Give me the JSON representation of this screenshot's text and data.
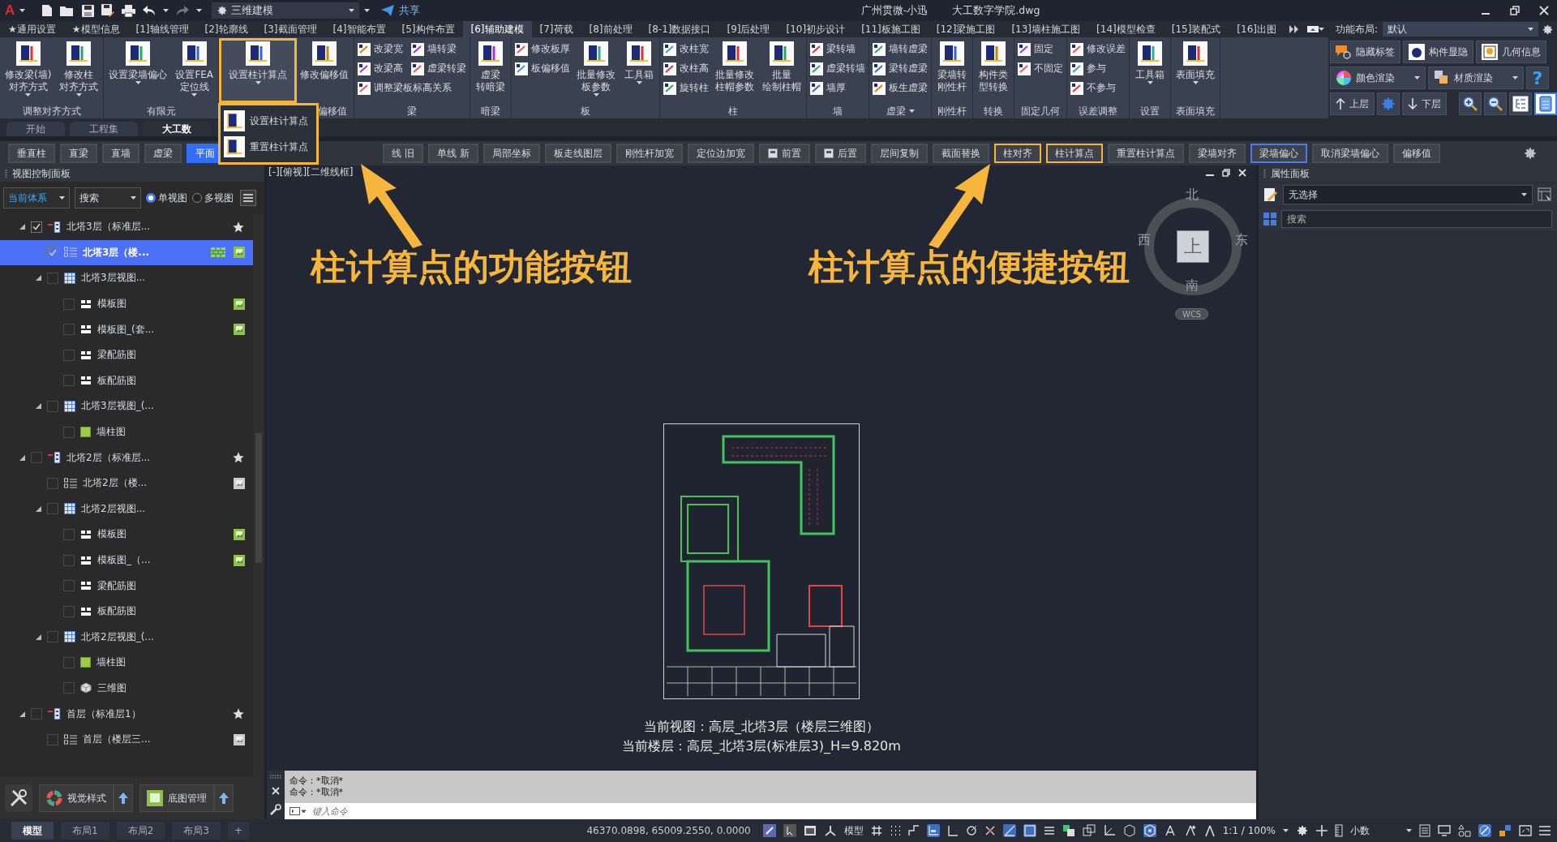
{
  "title_bar": {
    "app_logo": "A",
    "workspace": "三维建模",
    "share": "共享",
    "title": "广州贯微-小迅",
    "file": "大工数字学院.dwg"
  },
  "ribbon_tabs": [
    {
      "label": "★通用设置",
      "selected": false
    },
    {
      "label": "★模型信息",
      "selected": false
    },
    {
      "label": "[1]轴线管理",
      "selected": false
    },
    {
      "label": "[2]轮廓线",
      "selected": false
    },
    {
      "label": "[3]截面管理",
      "selected": false
    },
    {
      "label": "[4]智能布置",
      "selected": false
    },
    {
      "label": "[5]构件布置",
      "selected": false
    },
    {
      "label": "[6]辅助建模",
      "selected": true
    },
    {
      "label": "[7]荷载",
      "selected": false
    },
    {
      "label": "[8]前处理",
      "selected": false
    },
    {
      "label": "[8-1]数据接口",
      "selected": false
    },
    {
      "label": "[9]后处理",
      "selected": false
    },
    {
      "label": "[10]初步设计",
      "selected": false
    },
    {
      "label": "[11]板施工图",
      "selected": false
    },
    {
      "label": "[12]梁施工图",
      "selected": false
    },
    {
      "label": "[13]墙柱施工图",
      "selected": false
    },
    {
      "label": "[14]模型检查",
      "selected": false
    },
    {
      "label": "[15]装配式",
      "selected": false
    },
    {
      "label": "[16]出图",
      "selected": false
    }
  ],
  "function_layout": {
    "label": "功能布局:",
    "value": "默认"
  },
  "ribbon": {
    "groups": [
      {
        "label": "调整对齐方式",
        "label_menu": false,
        "columns": [
          {
            "kind": "large",
            "lines": [
              "修改梁(墙)",
              "对齐方式"
            ],
            "menu": true,
            "highlighted": false
          },
          {
            "kind": "large",
            "lines": [
              "修改柱",
              "对齐方式"
            ],
            "menu": true,
            "highlighted": false
          }
        ]
      },
      {
        "label": "有限元",
        "label_menu": false,
        "columns": [
          {
            "kind": "large",
            "lines": [
              "设置梁墙偏心"
            ],
            "menu": true,
            "highlighted": false
          },
          {
            "kind": "large",
            "lines": [
              "设置FEA",
              "定位线"
            ],
            "menu": true,
            "highlighted": false
          }
        ]
      },
      {
        "label": "偏移值",
        "label_menu": false,
        "columns": [
          {
            "kind": "large",
            "lines": [
              "设置柱计算点"
            ],
            "menu": true,
            "highlighted": true,
            "dropdown": [
              "设置柱计算点",
              "重置柱计算点"
            ]
          },
          {
            "kind": "large",
            "lines": [
              "修改偏移值"
            ],
            "menu": false,
            "highlighted": false
          }
        ]
      },
      {
        "label": "梁",
        "label_menu": false,
        "columns": [
          {
            "kind": "small",
            "rows": [
              [
                "改梁宽",
                "墙转梁"
              ],
              [
                "改梁高",
                "虚梁转梁"
              ],
              [
                "调整梁板标高关系"
              ]
            ]
          }
        ]
      },
      {
        "label": "暗梁",
        "label_menu": false,
        "columns": [
          {
            "kind": "large",
            "lines": [
              "虚梁",
              "转暗梁"
            ],
            "menu": false,
            "highlighted": false
          }
        ]
      },
      {
        "label": "板",
        "label_menu": false,
        "columns": [
          {
            "kind": "small",
            "rows": [
              [
                "修改板厚"
              ],
              [
                "板偏移值"
              ]
            ]
          },
          {
            "kind": "large",
            "lines": [
              "批量修改",
              "板参数"
            ],
            "menu": true,
            "highlighted": false
          },
          {
            "kind": "large",
            "lines": [
              "工具箱"
            ],
            "menu": true,
            "highlighted": false
          }
        ]
      },
      {
        "label": "柱",
        "label_menu": false,
        "columns": [
          {
            "kind": "small",
            "rows": [
              [
                "改柱宽"
              ],
              [
                "改柱高"
              ],
              [
                "旋转柱"
              ]
            ]
          },
          {
            "kind": "large",
            "lines": [
              "批量修改",
              "柱帽参数"
            ],
            "menu": false,
            "highlighted": false
          },
          {
            "kind": "large",
            "lines": [
              "批量",
              "绘制柱帽"
            ],
            "menu": false,
            "highlighted": false
          }
        ]
      },
      {
        "label": "墙",
        "label_menu": false,
        "columns": [
          {
            "kind": "small",
            "rows": [
              [
                "梁转墙"
              ],
              [
                "虚梁转墙"
              ],
              [
                "墙厚"
              ]
            ]
          }
        ]
      },
      {
        "label": "虚梁",
        "label_menu": true,
        "columns": [
          {
            "kind": "small",
            "rows": [
              [
                "墙转虚梁"
              ],
              [
                "梁转虚梁"
              ],
              [
                "板生虚梁"
              ]
            ]
          }
        ]
      },
      {
        "label": "刚性杆",
        "label_menu": false,
        "columns": [
          {
            "kind": "large",
            "lines": [
              "梁墙转",
              "刚性杆"
            ],
            "menu": false,
            "highlighted": false
          }
        ]
      },
      {
        "label": "转换",
        "label_menu": false,
        "columns": [
          {
            "kind": "large",
            "lines": [
              "构件类",
              "型转换"
            ],
            "menu": false,
            "highlighted": false
          }
        ]
      },
      {
        "label": "固定几何",
        "label_menu": false,
        "columns": [
          {
            "kind": "small",
            "rows": [
              [
                "固定"
              ],
              [
                "不固定"
              ]
            ]
          }
        ]
      },
      {
        "label": "误差调整",
        "label_menu": false,
        "columns": [
          {
            "kind": "small",
            "rows": [
              [
                "修改误差"
              ],
              [
                "参与"
              ],
              [
                "不参与"
              ]
            ]
          }
        ]
      },
      {
        "label": "设置",
        "label_menu": false,
        "columns": [
          {
            "kind": "large",
            "lines": [
              "工具箱"
            ],
            "menu": true,
            "highlighted": false
          }
        ]
      },
      {
        "label": "表面填充",
        "label_menu": false,
        "columns": [
          {
            "kind": "large",
            "lines": [
              "表面填充"
            ],
            "menu": true,
            "highlighted": false
          }
        ]
      }
    ]
  },
  "display_tools": {
    "tag_buttons": [
      "隐藏标签",
      "构件显隐",
      "几何信息"
    ],
    "render_buttons": [
      "颜色渲染",
      "材质渲染"
    ],
    "help": "?",
    "floor_up": "上层",
    "floor_down": "下层"
  },
  "doc_tabs": [
    {
      "label": "开始",
      "selected": false
    },
    {
      "label": "工程集",
      "selected": false
    },
    {
      "label": "大工数",
      "selected": true
    }
  ],
  "toolbar": [
    {
      "label": "垂直柱",
      "kind": "button",
      "selected": false,
      "focused": false,
      "highlighted": false
    },
    {
      "label": "直梁",
      "kind": "button",
      "selected": false,
      "focused": false,
      "highlighted": false
    },
    {
      "label": "直墙",
      "kind": "button",
      "selected": false,
      "focused": false,
      "highlighted": false
    },
    {
      "label": "虚梁",
      "kind": "button",
      "selected": false,
      "focused": false,
      "highlighted": false
    },
    {
      "label": "平面",
      "kind": "button",
      "selected": true,
      "focused": false,
      "highlighted": false
    },
    {
      "label": "线 旧",
      "kind": "button",
      "selected": false,
      "focused": false,
      "highlighted": false
    },
    {
      "label": "单线 新",
      "kind": "button",
      "selected": false,
      "focused": false,
      "highlighted": false
    },
    {
      "label": "局部坐标",
      "kind": "button",
      "selected": false,
      "focused": false,
      "highlighted": false
    },
    {
      "label": "板走线图层",
      "kind": "button",
      "selected": false,
      "focused": false,
      "highlighted": false
    },
    {
      "label": "刚性杆加宽",
      "kind": "button",
      "selected": false,
      "focused": false,
      "highlighted": false
    },
    {
      "label": "定位边加宽",
      "kind": "button",
      "selected": false,
      "focused": false,
      "highlighted": false
    },
    {
      "label": "前置",
      "kind": "toggle",
      "selected": false,
      "focused": false,
      "highlighted": false
    },
    {
      "label": "后置",
      "kind": "toggle",
      "selected": false,
      "focused": false,
      "highlighted": false
    },
    {
      "label": "层间复制",
      "kind": "button",
      "selected": false,
      "focused": false,
      "highlighted": false
    },
    {
      "label": "截面替换",
      "kind": "button",
      "selected": false,
      "focused": false,
      "highlighted": false
    },
    {
      "label": "柱对齐",
      "kind": "button",
      "selected": false,
      "focused": false,
      "highlighted": true
    },
    {
      "label": "柱计算点",
      "kind": "button",
      "selected": false,
      "focused": false,
      "highlighted": true
    },
    {
      "label": "重置柱计算点",
      "kind": "button",
      "selected": false,
      "focused": false,
      "highlighted": false
    },
    {
      "label": "梁墙对齐",
      "kind": "button",
      "selected": false,
      "focused": false,
      "highlighted": false
    },
    {
      "label": "梁墙偏心",
      "kind": "button",
      "selected": false,
      "focused": true,
      "highlighted": false
    },
    {
      "label": "取消梁墙偏心",
      "kind": "button",
      "selected": false,
      "focused": false,
      "highlighted": false
    },
    {
      "label": "偏移值",
      "kind": "button",
      "selected": false,
      "focused": false,
      "highlighted": false
    }
  ],
  "view_panel": {
    "title": "视图控制面板",
    "system": "当前体系",
    "search": "搜索",
    "modes": [
      {
        "label": "单视图",
        "selected": true
      },
      {
        "label": "多视图",
        "selected": false
      }
    ],
    "tree": [
      {
        "label": "北塔3层（标准层...",
        "kind": "floor",
        "checked": true,
        "selected": false,
        "expanded": true,
        "children": [
          {
            "label": "北塔3层（楼...",
            "kind": "model",
            "checked": true,
            "selected": true,
            "grid_badge": true,
            "thumbnail_ready": true
          },
          {
            "label": "北塔3层视图...",
            "kind": "viewset",
            "checked": false,
            "selected": false,
            "expanded": true,
            "children": [
              {
                "label": "模板图",
                "kind": "sheet",
                "checked": false,
                "selected": false,
                "thumbnail_ready": true
              },
              {
                "label": "模板图_(套...",
                "kind": "sheet",
                "checked": false,
                "selected": false,
                "thumbnail_ready": true
              },
              {
                "label": "梁配筋图",
                "kind": "sheet",
                "checked": false,
                "selected": false
              },
              {
                "label": "板配筋图",
                "kind": "sheet",
                "checked": false,
                "selected": false
              }
            ]
          },
          {
            "label": "北塔3层视图_(...",
            "kind": "viewset",
            "checked": false,
            "selected": false,
            "expanded": true,
            "children": [
              {
                "label": "墙柱图",
                "kind": "plan",
                "checked": false,
                "selected": false
              }
            ]
          }
        ]
      },
      {
        "label": "北塔2层（标准层...",
        "kind": "floor",
        "checked": false,
        "selected": false,
        "expanded": true,
        "children": [
          {
            "label": "北塔2层（楼...",
            "kind": "model",
            "checked": false,
            "selected": false,
            "thumbnail_ready": false
          },
          {
            "label": "北塔2层视图...",
            "kind": "viewset",
            "checked": false,
            "selected": false,
            "expanded": true,
            "children": [
              {
                "label": "模板图",
                "kind": "sheet",
                "checked": false,
                "selected": false,
                "thumbnail_ready": true
              },
              {
                "label": "模板图_（...",
                "kind": "sheet",
                "checked": false,
                "selected": false,
                "thumbnail_ready": true
              },
              {
                "label": "梁配筋图",
                "kind": "sheet",
                "checked": false,
                "selected": false
              },
              {
                "label": "板配筋图",
                "kind": "sheet",
                "checked": false,
                "selected": false
              }
            ]
          },
          {
            "label": "北塔2层视图_(...",
            "kind": "viewset",
            "checked": false,
            "selected": false,
            "expanded": true,
            "children": [
              {
                "label": "墙柱图",
                "kind": "plan",
                "checked": false,
                "selected": false
              },
              {
                "label": "三维图",
                "kind": "cube",
                "checked": false,
                "selected": false
              }
            ]
          }
        ]
      },
      {
        "label": "首层（标准层1）",
        "kind": "floor",
        "checked": false,
        "selected": false,
        "expanded": true,
        "children": [
          {
            "label": "首层（楼层三...",
            "kind": "model",
            "checked": false,
            "selected": false,
            "thumbnail_ready": false
          }
        ]
      }
    ],
    "bottom_buttons": [
      "视觉样式",
      "底图管理"
    ]
  },
  "viewport": {
    "header": "[-][俯视][二维线框]",
    "compass": {
      "north": "北",
      "south": "南",
      "east": "东",
      "west": "西",
      "face": "上",
      "ucs": "WCS"
    },
    "annotations": [
      "柱计算点的功能按钮",
      "柱计算点的便捷按钮"
    ],
    "current_view": "当前视图：高层_北塔3层（楼层三维图）",
    "current_floor": "当前楼层：高层_北塔3层(标准层3)_H=9.820m"
  },
  "command": {
    "history": [
      "命令：*取消*",
      "命令：*取消*"
    ],
    "placeholder": "键入命令"
  },
  "properties_panel": {
    "title": "属性面板",
    "selection": "无选择",
    "search_placeholder": "搜索"
  },
  "status_bar": {
    "layout_tabs": [
      {
        "label": "模型",
        "selected": true
      },
      {
        "label": "布局1",
        "selected": false
      },
      {
        "label": "布局2",
        "selected": false
      },
      {
        "label": "布局3",
        "selected": false
      }
    ],
    "add_tab": "+",
    "coordinates": "46370.0898, 65009.2550, 0.0000",
    "space": "模型",
    "scale": "1:1 / 100%",
    "units": "小数"
  }
}
